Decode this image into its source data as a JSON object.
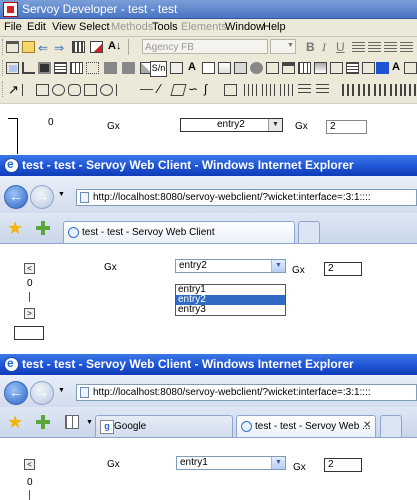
{
  "servoy": {
    "title": "Servoy Developer - test - test",
    "menu": [
      {
        "label": "File",
        "enabled": true
      },
      {
        "label": "Edit",
        "enabled": true
      },
      {
        "label": "View",
        "enabled": true
      },
      {
        "label": "Select",
        "enabled": true
      },
      {
        "label": "Methods",
        "enabled": false
      },
      {
        "label": "Tools",
        "enabled": true
      },
      {
        "label": "Elements",
        "enabled": false
      },
      {
        "label": "Window",
        "enabled": true
      },
      {
        "label": "Help",
        "enabled": true
      }
    ],
    "font_name": "Agency FB",
    "format_buttons": {
      "bold": "B",
      "italic": "I",
      "underline": "U"
    },
    "designer": {
      "slider_value": "0",
      "label1": "Gx",
      "combo_value": "entry2",
      "label2": "Gx",
      "text_value": "2"
    }
  },
  "window1": {
    "title": "test - test - Servoy Web Client - Windows Internet Explorer",
    "url": "http://localhost:8080/servoy-webclient/?wicket:interface=:3:1::::",
    "tab_label": "test - test - Servoy Web Client",
    "form": {
      "up_btn": "<",
      "down_btn": ">",
      "slider_value": "0",
      "label1": "Gx",
      "combo_value": "entry2",
      "label2": "Gx",
      "text_value": "2",
      "options": [
        "entry1",
        "entry2",
        "entry3"
      ],
      "selected_option": "entry2"
    }
  },
  "window2": {
    "title": "test - test - Servoy Web Client - Windows Internet Explorer",
    "url": "http://localhost:8080/servoy-webclient/?wicket:interface=:3:1::::",
    "tabs": [
      {
        "label": "Google",
        "active": false
      },
      {
        "label": "test - test - Servoy Web ...",
        "active": true
      }
    ],
    "form": {
      "up_btn": "<",
      "slider_value": "0",
      "label1": "Gx",
      "combo_value": "entry1",
      "label2": "Gx",
      "text_value": "2"
    }
  },
  "colors": {
    "xp_title_blue": "#1f54d4",
    "selection_blue": "#316ac5",
    "toolbar_bg": "#ece9d8"
  }
}
